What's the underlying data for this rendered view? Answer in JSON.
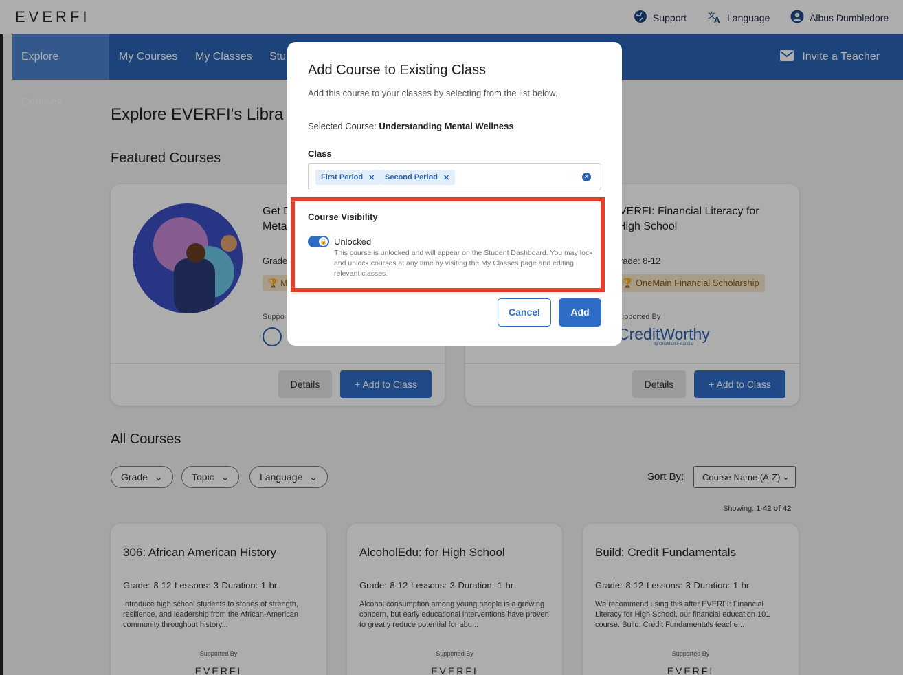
{
  "header": {
    "logo": "EVERFI",
    "support": "Support",
    "language": "Language",
    "user": "Albus Dumbledore"
  },
  "nav": {
    "items": [
      "Explore Courses",
      "My Courses",
      "My Classes",
      "Stu"
    ],
    "invite": "Invite a Teacher"
  },
  "main": {
    "page_title": "Explore EVERFI's Libra",
    "featured_heading": "Featured Courses",
    "featured": [
      {
        "title_line1": "Get D",
        "title_line2": "Meta",
        "grade": "Grade",
        "badge": "M",
        "supported": "Suppo",
        "details": "Details",
        "add": "Add to Class"
      },
      {
        "title_line1": "VERFI: Financial Literacy for",
        "title_line2": "High School",
        "grade": "rade: 8-12",
        "badge": "OneMain Financial Scholarship",
        "supported": "upported By",
        "sponsor": "CreditWorthy",
        "sponsor_sub": "by OneMain Financial",
        "details": "Details",
        "add": "Add to Class"
      }
    ],
    "all_heading": "All Courses",
    "filters": [
      "Grade",
      "Topic",
      "Language"
    ],
    "sort_label": "Sort By:",
    "sort_value": "Course Name (A-Z)",
    "showing_label": "Showing:",
    "showing_value": "1-42 of 42",
    "courses": [
      {
        "title": "306: African American History",
        "meta": "Grade: 8-12   Lessons: 3   Duration: 1 hr",
        "desc": "Introduce high school students to stories of strength, resilience, and leadership from the African-American community throughout history...",
        "supported": "Supported By",
        "brand": "EVERFI"
      },
      {
        "title": "AlcoholEdu: for High School",
        "meta": "Grade: 8-12   Lessons: 3   Duration: 1 hr",
        "desc": "Alcohol consumption among young people is a growing concern, but early educational interventions have proven to greatly reduce potential for abu...",
        "supported": "Supported By",
        "brand": "EVERFI"
      },
      {
        "title": "Build: Credit Fundamentals",
        "meta": "Grade: 8-12   Lessons: 3   Duration: 1 hr",
        "desc": "We recommend using this after EVERFI: Financial Literacy for High School, our financial education 101 course. Build: Credit Fundamentals teache...",
        "supported": "Supported By",
        "brand": "EVERFI"
      }
    ]
  },
  "modal": {
    "title": "Add Course to Existing Class",
    "subtitle": "Add this course to your classes by selecting from the list below.",
    "selected_label": "Selected Course:",
    "selected_value": "Understanding Mental Wellness",
    "class_label": "Class",
    "chips": [
      "First Period",
      "Second Period"
    ],
    "visibility_label": "Course Visibility",
    "toggle_label": "Unlocked",
    "help": "This course is unlocked and will appear on the Student Dashboard. You may lock and unlock courses at any time by visiting the My Classes page and editing relevant classes.",
    "cancel": "Cancel",
    "add": "Add"
  }
}
